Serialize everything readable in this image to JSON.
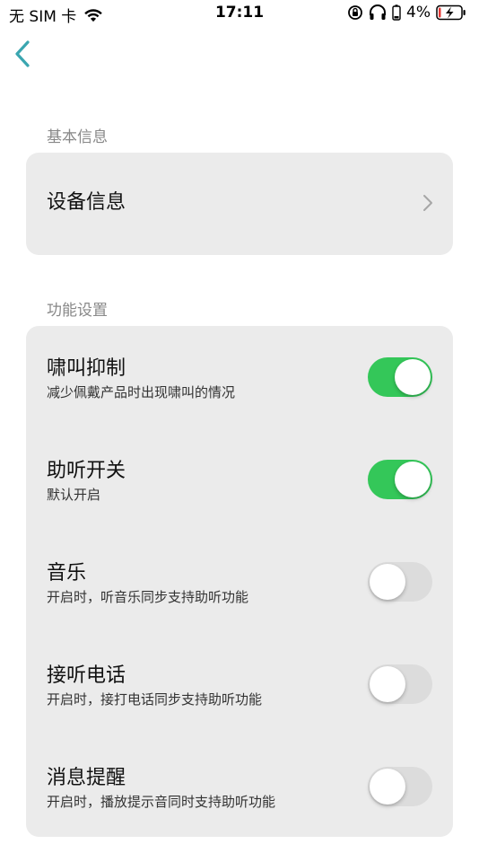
{
  "status_bar": {
    "carrier": "无 SIM 卡",
    "time": "17:11",
    "battery": "4%"
  },
  "sections": {
    "basic": {
      "header": "基本信息",
      "device_info_label": "设备信息"
    },
    "features": {
      "header": "功能设置",
      "items": [
        {
          "title": "啸叫抑制",
          "subtitle": "减少佩戴产品时出现啸叫的情况",
          "enabled": true
        },
        {
          "title": "助听开关",
          "subtitle": "默认开启",
          "enabled": true
        },
        {
          "title": "音乐",
          "subtitle": "开启时，听音乐同步支持助听功能",
          "enabled": false
        },
        {
          "title": "接听电话",
          "subtitle": "开启时，接打电话同步支持助听功能",
          "enabled": false
        },
        {
          "title": "消息提醒",
          "subtitle": "开启时，播放提示音同时支持助听功能",
          "enabled": false
        }
      ]
    }
  },
  "colors": {
    "accent": "#3aa6b0",
    "toggle_on": "#34c759",
    "toggle_off": "#dcdcdc",
    "card_bg": "#ebebeb"
  }
}
